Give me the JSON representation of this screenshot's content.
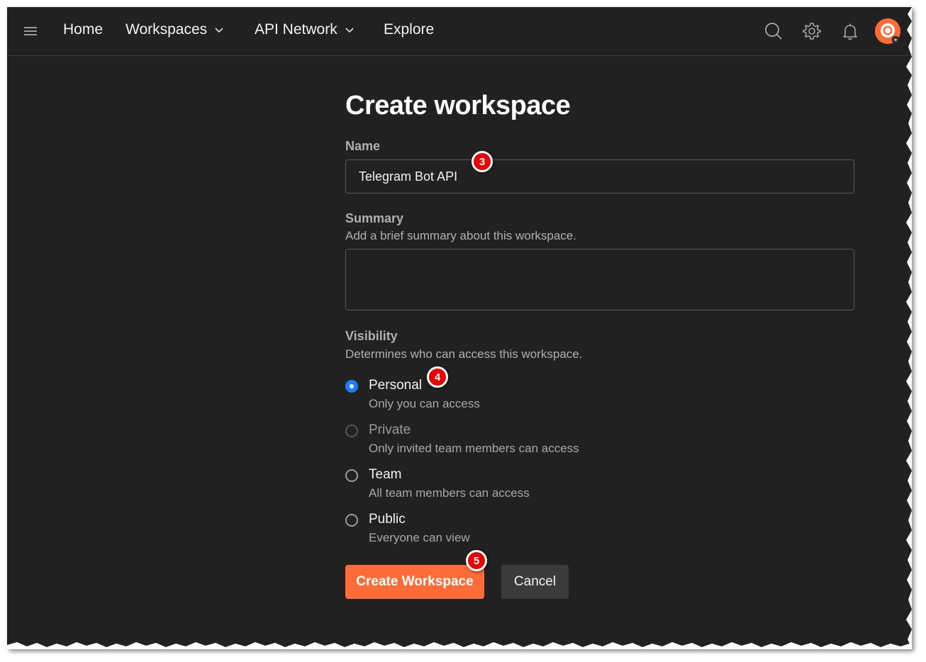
{
  "topbar": {
    "nav": [
      {
        "label": "Home"
      },
      {
        "label": "Workspaces"
      },
      {
        "label": "API Network"
      },
      {
        "label": "Explore"
      }
    ],
    "icons": [
      "menu-icon",
      "search-icon",
      "gear-icon",
      "bell-icon",
      "avatar"
    ]
  },
  "page": {
    "title": "Create workspace",
    "name": {
      "label": "Name",
      "value": "Telegram Bot API"
    },
    "summary": {
      "label": "Summary",
      "help": "Add a brief summary about this workspace.",
      "value": ""
    },
    "visibility": {
      "label": "Visibility",
      "help": "Determines who can access this workspace.",
      "selected": "Personal",
      "options": [
        {
          "title": "Personal",
          "desc": "Only you can access"
        },
        {
          "title": "Private",
          "desc": "Only invited team members can access"
        },
        {
          "title": "Team",
          "desc": "All team members can access"
        },
        {
          "title": "Public",
          "desc": "Everyone can view"
        }
      ]
    },
    "buttons": {
      "create": "Create Workspace",
      "cancel": "Cancel"
    }
  },
  "callouts": [
    "3",
    "4",
    "5"
  ],
  "colors": {
    "background": "#212121",
    "accent": "#ff6c37",
    "radio_selected": "#1e7ef7",
    "callout": "#e60000"
  }
}
